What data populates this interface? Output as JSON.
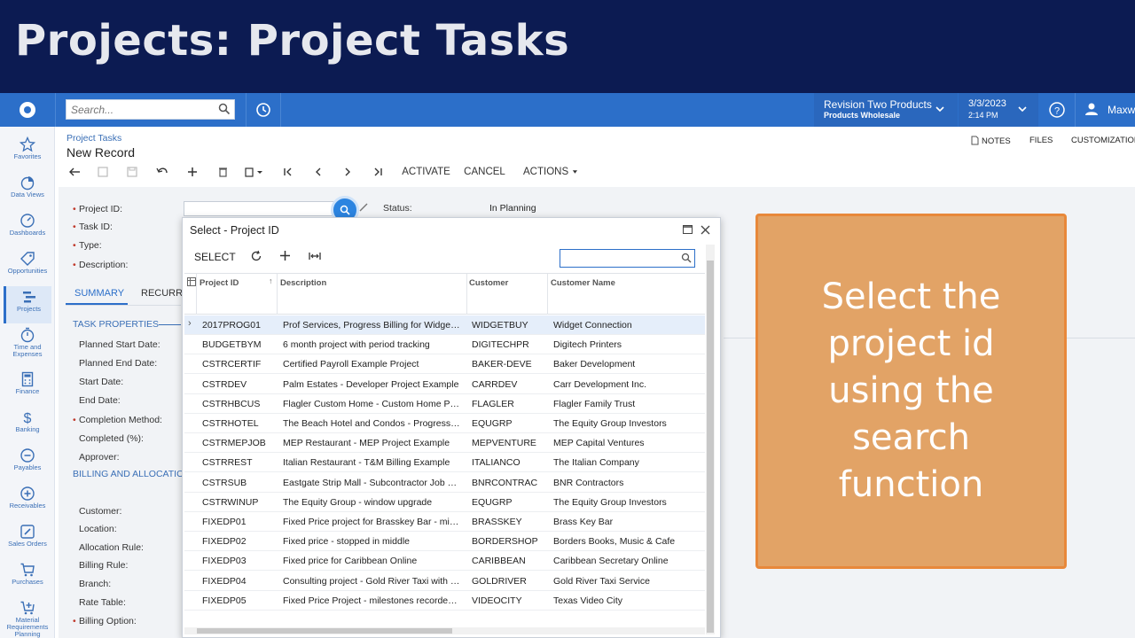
{
  "banner": {
    "title": "Projects: Project Tasks"
  },
  "topbar": {
    "search_placeholder": "Search...",
    "tenant_name": "Revision Two Products",
    "tenant_branch": "Products Wholesale",
    "date": "3/3/2023",
    "time": "2:14 PM",
    "user": "Maxw"
  },
  "nav": [
    {
      "label": "Favorites",
      "icon": "star-icon"
    },
    {
      "label": "Data Views",
      "icon": "pie-chart-icon"
    },
    {
      "label": "Dashboards",
      "icon": "gauge-icon"
    },
    {
      "label": "Opportunities",
      "icon": "tag-icon"
    },
    {
      "label": "Projects",
      "icon": "projects-icon"
    },
    {
      "label": "Time and Expenses",
      "icon": "stopwatch-icon"
    },
    {
      "label": "Finance",
      "icon": "calculator-icon"
    },
    {
      "label": "Banking",
      "icon": "dollar-icon"
    },
    {
      "label": "Payables",
      "icon": "minus-circle-icon"
    },
    {
      "label": "Receivables",
      "icon": "plus-circle-icon"
    },
    {
      "label": "Sales Orders",
      "icon": "pencil-icon"
    },
    {
      "label": "Purchases",
      "icon": "cart-icon"
    },
    {
      "label": "Material Requirements Planning",
      "icon": "cart-plus-icon"
    }
  ],
  "page": {
    "breadcrumb": "Project Tasks",
    "title": "New Record",
    "notes": "NOTES",
    "files": "FILES",
    "customization": "CUSTOMIZATION",
    "activate": "ACTIVATE",
    "cancel": "CANCEL",
    "actions": "ACTIONS"
  },
  "form": {
    "project_id": "Project ID:",
    "task_id": "Task ID:",
    "type": "Type:",
    "description": "Description:",
    "status_label": "Status:",
    "status_value": "In Planning",
    "tab_summary": "SUMMARY",
    "tab_recurring": "RECURRI",
    "section_task": "TASK PROPERTIES",
    "planned_start": "Planned Start Date:",
    "planned_end": "Planned End Date:",
    "start_date": "Start Date:",
    "end_date": "End Date:",
    "completion_method": "Completion Method:",
    "completed_pct": "Completed (%):",
    "approver": "Approver:",
    "section_billing": "BILLING AND ALLOCATION",
    "customer": "Customer:",
    "location": "Location:",
    "allocation_rule": "Allocation Rule:",
    "billing_rule": "Billing Rule:",
    "branch": "Branch:",
    "rate_table": "Rate Table:",
    "billing_option": "Billing Option:"
  },
  "dialog": {
    "title": "Select - Project ID",
    "select_label": "SELECT",
    "columns": [
      "Project ID",
      "Description",
      "Customer",
      "Customer Name"
    ],
    "rows": [
      [
        "2017PROG01",
        "Prof Services, Progress Billing for Widget ...",
        "WIDGETBUY",
        "Widget Connection"
      ],
      [
        "BUDGETBYM",
        "6 month project with period tracking",
        "DIGITECHPR",
        "Digitech Printers"
      ],
      [
        "CSTRCERTIF",
        "Certified Payroll Example Project",
        "BAKER-DEVE",
        "Baker Development"
      ],
      [
        "CSTRDEV",
        "Palm Estates - Developer Project Example",
        "CARRDEV",
        "Carr Development Inc."
      ],
      [
        "CSTRHBCUS",
        "Flagler Custom Home - Custom Home Proj...",
        "FLAGLER",
        "Flagler Family Trust"
      ],
      [
        "CSTRHOTEL",
        "The Beach Hotel and Condos - Progress Bi...",
        "EQUGRP",
        "The Equity Group Investors"
      ],
      [
        "CSTRMEPJOB",
        "MEP Restaurant - MEP Project Example",
        "MEPVENTURE",
        "MEP Capital Ventures"
      ],
      [
        "CSTRREST",
        "Italian Restaurant - T&M Billing Example",
        "ITALIANCO",
        "The Italian Company"
      ],
      [
        "CSTRSUB",
        "Eastgate Strip Mall - Subcontractor Job Ex...",
        "BNRCONTRAC",
        "BNR Contractors"
      ],
      [
        "CSTRWINUP",
        "The Equity Group - window upgrade",
        "EQUGRP",
        "The Equity Group Investors"
      ],
      [
        "FIXEDP01",
        "Fixed Price project for Brasskey Bar - miles...",
        "BRASSKEY",
        "Brass Key Bar"
      ],
      [
        "FIXEDP02",
        "Fixed price - stopped in middle",
        "BORDERSHOP",
        "Borders Books, Music & Cafe"
      ],
      [
        "FIXEDP03",
        "Fixed price for Caribbean Online",
        "CARIBBEAN",
        "Caribbean Secretary Online"
      ],
      [
        "FIXEDP04",
        "Consulting project - Gold River Taxi with ad...",
        "GOLDRIVER",
        "Gold River Taxi Service"
      ],
      [
        "FIXEDP05",
        "Fixed Price Project - milestones recorded b...",
        "VIDEOCITY",
        "Texas Video City"
      ]
    ]
  },
  "callout": {
    "text": "Select the project id using the search function"
  },
  "colors": {
    "banner": "#0c1b52",
    "topbar": "#2c6fc9",
    "callout": "#e2a366",
    "callout_border": "#e8883a"
  }
}
